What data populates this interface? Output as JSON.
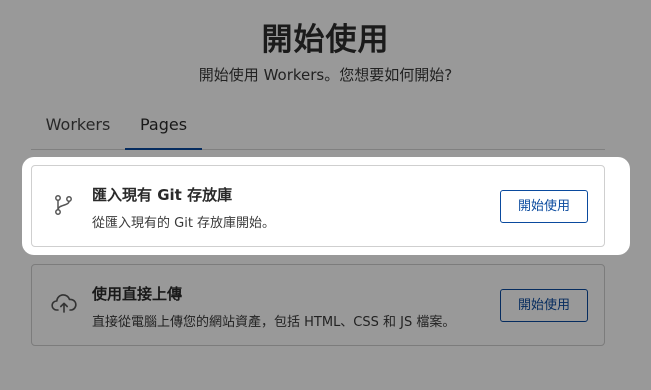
{
  "header": {
    "title": "開始使用",
    "subtitle": "開始使用 Workers。您想要如何開始?"
  },
  "tabs": [
    {
      "label": "Workers",
      "active": false
    },
    {
      "label": "Pages",
      "active": true
    }
  ],
  "cards": {
    "git": {
      "icon": "git-branch-icon",
      "title": "匯入現有 Git 存放庫",
      "description": "從匯入現有的 Git 存放庫開始。",
      "button_label": "開始使用"
    },
    "upload": {
      "icon": "cloud-upload-icon",
      "title": "使用直接上傳",
      "description": "直接從電腦上傳您的網站資產，包括 HTML、CSS 和 JS 檔案。",
      "button_label": "開始使用"
    }
  },
  "colors": {
    "accent": "#0a4a9e",
    "overlay": "rgba(0,0,0,0.40)",
    "border": "#cfcfcf"
  }
}
